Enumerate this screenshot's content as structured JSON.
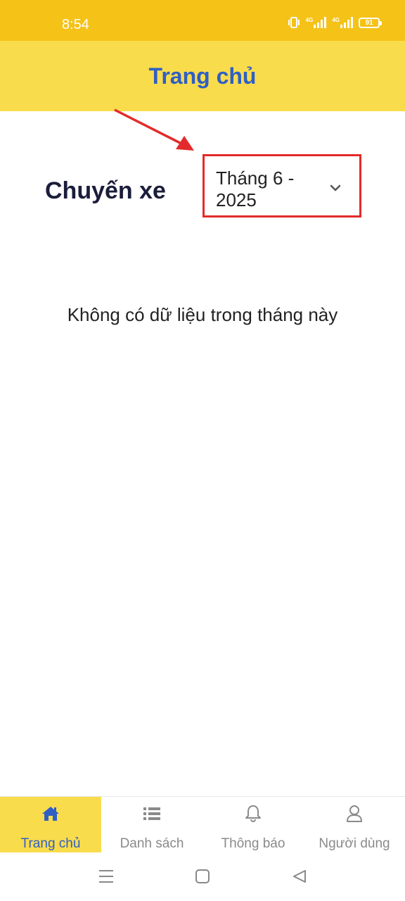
{
  "status_bar": {
    "time": "8:54",
    "network_1": "4G",
    "network_2": "4G",
    "battery": "91"
  },
  "header": {
    "title": "Trang chủ"
  },
  "main": {
    "section_title": "Chuyến xe",
    "month_select": {
      "value": "Tháng 6 - 2025",
      "icon": "chevron-down-icon"
    },
    "empty_message": "Không có dữ liệu trong tháng này"
  },
  "bottom_nav": {
    "items": [
      {
        "label": "Trang chủ",
        "icon": "home-icon",
        "active": true
      },
      {
        "label": "Danh sách",
        "icon": "list-icon",
        "active": false
      },
      {
        "label": "Thông báo",
        "icon": "bell-icon",
        "active": false
      },
      {
        "label": "Người dùng",
        "icon": "user-icon",
        "active": false
      }
    ]
  },
  "colors": {
    "status_bar": "#f5c218",
    "header": "#f9dc4c",
    "accent": "#2f5fc4",
    "annotation": "#e32b2b"
  }
}
